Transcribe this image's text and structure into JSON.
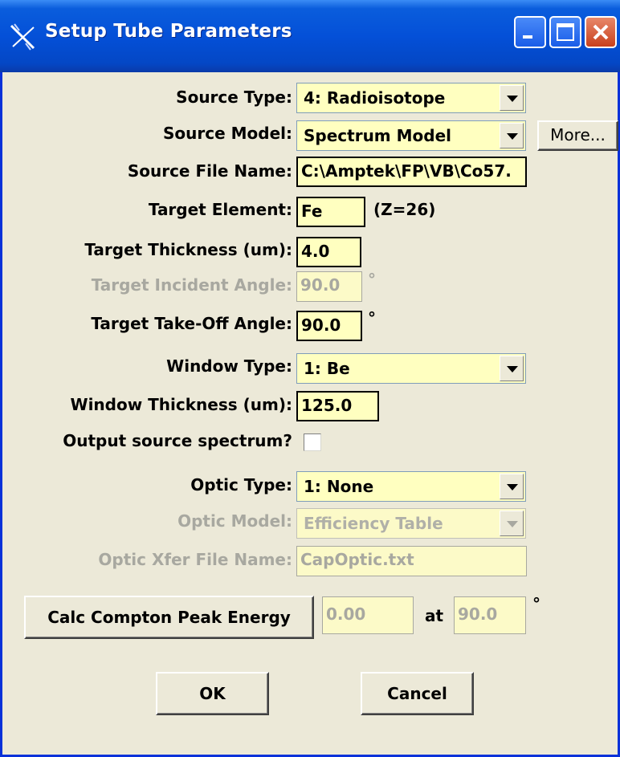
{
  "window": {
    "title": "Setup Tube Parameters",
    "icon": "x-ray-source-icon",
    "controls": [
      "minimize-icon",
      "maximize-icon",
      "close-icon"
    ]
  },
  "form": {
    "source_type": {
      "label": "Source Type:",
      "value": "4: Radioisotope"
    },
    "source_model": {
      "label": "Source Model:",
      "value": "Spectrum Model",
      "more_label": "More..."
    },
    "source_file": {
      "label": "Source File Name:",
      "value": "C:\\Amptek\\FP\\VB\\Co57."
    },
    "target_element": {
      "label": "Target Element:",
      "value": "Fe",
      "z_text": "(Z=26)"
    },
    "target_thickness": {
      "label": "Target Thickness (um):",
      "value": "4.0"
    },
    "target_incident_angle": {
      "label": "Target Incident Angle:",
      "value": "90.0",
      "unit": "°"
    },
    "target_takeoff_angle": {
      "label": "Target Take-Off Angle:",
      "value": "90.0",
      "unit": "°"
    },
    "window_type": {
      "label": "Window Type:",
      "value": "1: Be"
    },
    "window_thickness": {
      "label": "Window Thickness (um):",
      "value": "125.0"
    },
    "output_spectrum": {
      "label": "Output source spectrum?",
      "checked": false
    },
    "optic_type": {
      "label": "Optic Type:",
      "value": "1: None"
    },
    "optic_model": {
      "label": "Optic Model:",
      "value": "Efficiency Table"
    },
    "optic_xfer_file": {
      "label": "Optic Xfer File Name:",
      "value": "CapOptic.txt"
    },
    "compton": {
      "button_label": "Calc Compton Peak Energy",
      "energy": "0.00",
      "at_label": "at",
      "angle": "90.0",
      "unit": "°"
    }
  },
  "buttons": {
    "ok": "OK",
    "cancel": "Cancel"
  }
}
